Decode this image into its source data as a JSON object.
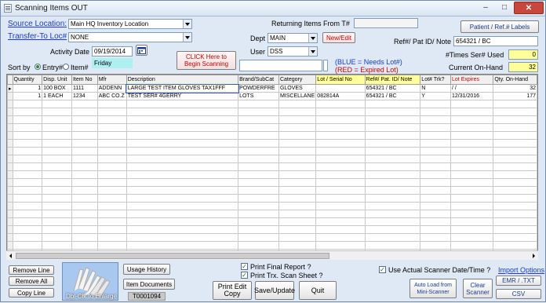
{
  "window": {
    "title": "Scanning Items OUT",
    "minimize": "–",
    "maximize": "□",
    "close": "✕"
  },
  "source_location": {
    "label": "Source Location:",
    "value": "Main HQ Inventory Location"
  },
  "transfer_to": {
    "label": "Transfer-To Loc#",
    "value": "NONE"
  },
  "activity_date": {
    "label": "Activity Date",
    "value": "09/19/2014",
    "day": "Friday"
  },
  "sort_by": {
    "label": "Sort by",
    "entry": "Entry#",
    "item": "Item#"
  },
  "begin_scanning": "CLICK Here to Begin Scanning",
  "returning_from": {
    "label": "Returning Items From T#",
    "value": ""
  },
  "dept": {
    "label": "Dept",
    "value": "MAIN"
  },
  "user": {
    "label": "User",
    "value": "DSS"
  },
  "new_edit": "New/Edit",
  "legend": {
    "blue": "(BLUE = Needs Lot#)",
    "red": "(RED = Expired Lot)"
  },
  "patient_labels": "Patient / Ref.# Labels",
  "ref_patient": {
    "label": "Ref#/ Pat ID/ Note",
    "value": "654321 / BC"
  },
  "times_used": {
    "label": "#Times Ser# Used",
    "value": "0"
  },
  "on_hand": {
    "label": "Current On-Hand",
    "value": "32"
  },
  "table": {
    "headers": [
      "Quantity",
      "Disp. Unit",
      "Item No",
      "Mfr",
      "Description",
      "Brand/SubCat",
      "Category",
      "Lot / Serial No",
      "Ref#/ Pat. ID/ Note",
      "Lot# Trk?",
      "Lot Expires",
      "Qty. On-Hand"
    ],
    "rows": [
      [
        "1",
        "100 BOX",
        "1111",
        "ADDENN",
        "LARGE TEST ITEM GLOVES TAX1FFF",
        "POWDERFRE",
        "GLOVES",
        "",
        "654321 / BC",
        "N",
        "/ /",
        "32"
      ],
      [
        "1",
        "1 EACH",
        "1234",
        "ABC CO.Z",
        "TEST SER# 4GERRY",
        "LOTS",
        "MISCELLANE",
        "082814A",
        "654321 / BC",
        "Y",
        "12/31/2016",
        "177"
      ]
    ]
  },
  "bottom": {
    "remove_line": "Remove Line",
    "remove_all": "Remove All",
    "copy_line": "Copy Line",
    "thumb_caption": "Dbl-Clk to Enlarge",
    "usage_history": "Usage History",
    "item_documents": "Item Documents",
    "doc_number": "T0001094",
    "print_final": "Print Final Report ?",
    "print_trx": "Print Trx. Scan Sheet ?",
    "print_edit_copy": "Print Edit Copy",
    "save_update": "Save/Update",
    "quit": "Quit",
    "use_actual": "Use Actual Scanner Date/Time ?",
    "auto_load": "Auto Load from Mini-Scanner",
    "clear_scanner": "Clear Scanner",
    "import_options": "Import Options",
    "emr_txt": "EMR / .TXT",
    "csv": "CSV"
  }
}
